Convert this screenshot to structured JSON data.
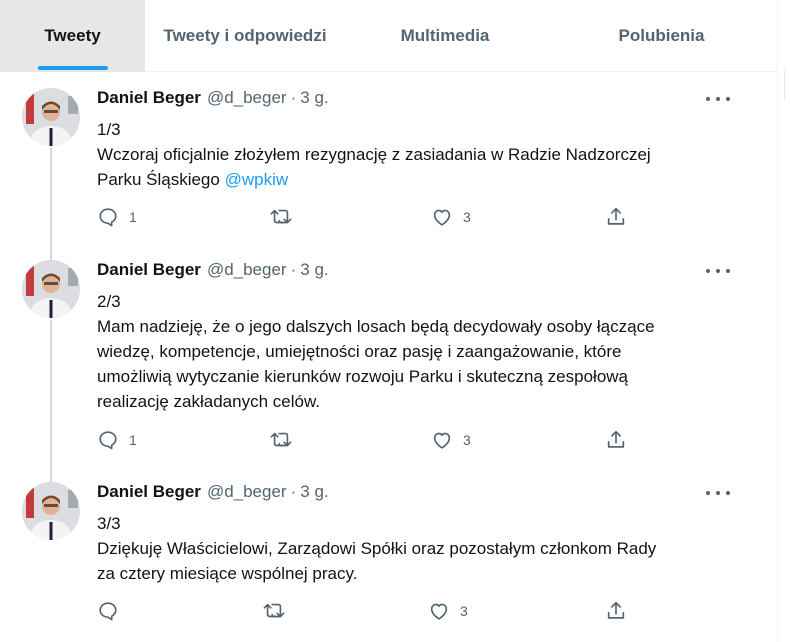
{
  "tabs": [
    {
      "label": "Tweety",
      "active": true
    },
    {
      "label": "Tweety i odpowiedzi",
      "active": false
    },
    {
      "label": "Multimedia",
      "active": false
    },
    {
      "label": "Polubienia",
      "active": false
    }
  ],
  "tweets": [
    {
      "name": "Daniel Beger",
      "handle": "@d_beger",
      "sep": "·",
      "time": "3 g.",
      "lines": [
        "1/3",
        "Wczoraj oficjalnie złożyłem rezygnację  z zasiadania w Radzie Nadzorczej"
      ],
      "last_line_text": "Parku Śląskiego ",
      "mention": "@wpkiw",
      "replies": "1",
      "retweets": "",
      "likes": "3"
    },
    {
      "name": "Daniel Beger",
      "handle": "@d_beger",
      "sep": "·",
      "time": "3 g.",
      "lines": [
        "2/3",
        "Mam nadzieję, że o jego dalszych losach będą decydowały osoby łączące",
        "wiedzę, kompetencje, umiejętności oraz pasję i zaangażowanie, które",
        "umożliwią wytyczanie kierunków rozwoju Parku i skuteczną zespołową",
        "realizację zakładanych celów."
      ],
      "replies": "1",
      "retweets": "",
      "likes": "3"
    },
    {
      "name": "Daniel Beger",
      "handle": "@d_beger",
      "sep": "·",
      "time": "3 g.",
      "lines": [
        "3/3",
        "Dziękuję Właścicielowi, Zarządowi Spółki oraz pozostałym członkom Rady",
        "za cztery miesiące wspólnej pracy."
      ],
      "replies": "",
      "retweets": "",
      "likes": "3"
    }
  ],
  "icons": {
    "reply": "reply-icon",
    "retweet": "retweet-icon",
    "like": "like-icon",
    "share": "share-icon",
    "more": "more-icon"
  },
  "colors": {
    "accent": "#1d9bf0",
    "secondary_text": "#536471",
    "thread_line": "#cfd9de"
  }
}
